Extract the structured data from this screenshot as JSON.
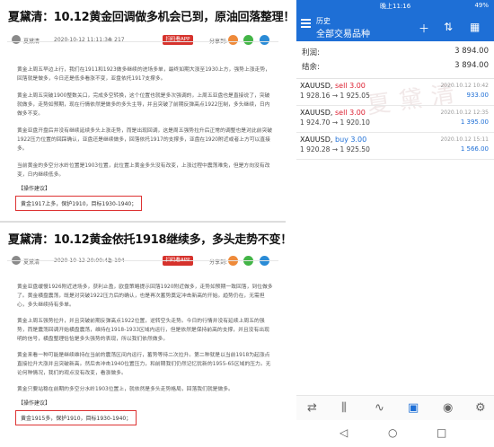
{
  "article1": {
    "title": "夏黛清：10.12黄金回调做多机会已到，原油回落整理！",
    "author": "夏黛清",
    "date": "2020-10-12 11:11:34",
    "views": "217",
    "app_button": "扫码看APP",
    "share_label": "分享到:",
    "paragraphs": [
      "黄金上周五早边上行，我们在1911和1923做多继续的进场多单，最终如期大涨至1930上方，强势上涨走势，回落就是做多，今日还是低多看涨不变，亚盘依托1917支撑多。",
      "黄金上周五突破1900整数关口，完成多空转换，这个位置也就是多次强调的，上周五亚盘也是直接说了，突破就做多，走势如预期，现在行情依然是做多的多头主导，并且突破了前期反弹高点1922压制，多头继续，日内做多不变。",
      "黄金亚盘开盘后并没有继续延续多头上涨走势，而是出现回调，这是周五强势拉升后正常的调整也是对此前突破1922压力位置的回踩确认，亚盘还是继续做多，回落依托1917的支撑多，亚盘在1920附近或者上方可以直接多。",
      "当前黄金的多空分水岭位置是1903位置，此位置上黄金多头没有改变，上涨过程中震荡难免，但是方向没有改变，日内继续低多。"
    ],
    "op_label": "【操作建议】",
    "advice": "黄金1917上多，保护1910，目标1930-1940；"
  },
  "article2": {
    "title": "夏黛清：10.12黄金依托1918继续多，多头走势不变！",
    "author": "夏黛清",
    "date": "2020-10-12 20:00:42",
    "views": "194",
    "app_button": "扫码看APP",
    "share_label": "分享到:",
    "paragraphs": [
      "黄金亚盘缓慢1926附近进场多，获利止盈，欧盘策略提示回落1920附近做多，走势如预期一致回落，到位做多了。黄金横盘震荡，既是对突破1922压力后的确认，也是再次蓄势奠定冲击新高的开始。趋势仍在，无需担心，多头继续持有多单。",
      "黄金上周五强势拉升，并且突破前期反弹高点1922位置，逆转空头走势。今日的行情并没有延续上周五的强势，而是震荡回调开始横盘震荡，维持在1918-1933区域内运行，但是依然是保持前高的支撑，并且没有出现明的信号，横盘整理恰恰是多头强势的表现，所以我们依然做多。",
      "黄金来看一种可能是继续维持在当前的震荡区间内运行，蓄势等待二次拉升。第二种就是以当前1918为起涨点直接拉升大涨并且突破新高。然后去冲击1940位置压力，和前期我们仍然记忆犹新的1955-65区域的压力。无论何种情况，我们的观点没有改变，看涨做多。",
      "黄金只要站稳在前期的多空分水岭1903位置上，就依然是多头走势格局，回落我们就是做多。"
    ],
    "op_label": "【操作建议】",
    "advice": "黄金1915多，保护1910，目标1930-1940；"
  },
  "app": {
    "status_time": "晚上11:16",
    "battery": "49%",
    "subtitle": "历史",
    "title": "全部交易品种",
    "icons": [
      "menu-icon",
      "plus-icon",
      "sort-icon",
      "calendar-icon"
    ],
    "profit_label": "利润:",
    "profit_value": "3 894.00",
    "balance_label": "结余:",
    "balance_value": "3 894.00",
    "trades": [
      {
        "symbol": "XAUUSD,",
        "side": "sell 3.00",
        "side_type": "sell",
        "time": "2020.10.12 10:42",
        "prices": "1 928.16 → 1 925.05",
        "profit": "933.00"
      },
      {
        "symbol": "XAUUSD,",
        "side": "sell 3.00",
        "side_type": "sell",
        "time": "2020.10.12 12:35",
        "prices": "1 924.70 → 1 920.10",
        "profit": "1 395.00"
      },
      {
        "symbol": "XAUUSD,",
        "side": "buy 3.00",
        "side_type": "buy",
        "time": "2020.10.12 15:11",
        "prices": "1 920.28 → 1 925.50",
        "profit": "1 566.00"
      }
    ],
    "watermark": "夏黛清"
  },
  "colors": {
    "accent": "#1e6fd6",
    "sell": "#dd2233",
    "box_border": "#dd3333"
  }
}
